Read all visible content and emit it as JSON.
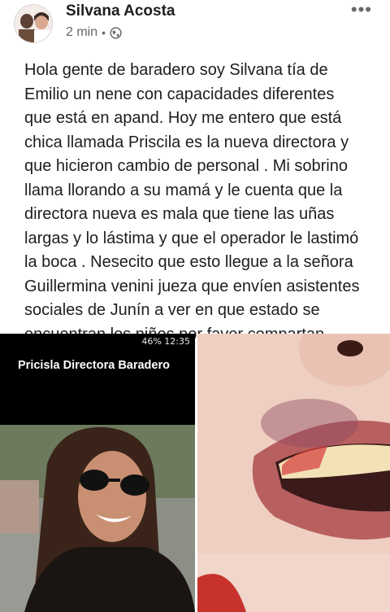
{
  "post": {
    "author": "Silvana Acosta",
    "time": "2 min",
    "separator": "•",
    "privacy_icon": "globe-icon",
    "more_label": "•••",
    "text_lines": [
      "Hola gente de baradero soy Silvana tía de",
      "Emilio un nene con capacidades diferentes",
      "que está en apand.  Hoy me entero que está",
      "chica llamada Priscila es la nueva directora y",
      "que hicieron cambio de personal . Mi sobrino",
      "llama llorando a su mamá y le cuenta que la",
      "directora nueva es mala que tiene las uñas",
      "largas y lo lástima y que el operador le lastimó",
      "la boca . Nesecito que esto llegue a la señora",
      "Guillermina venini jueza que envíen asistentes",
      "sociales de Junín a ver en que estado se",
      "encuentran los niños por favor compartan"
    ]
  },
  "photos": {
    "left": {
      "status_bar": "46% 12:35",
      "caption": "Pricisla Directora Baradero"
    }
  }
}
